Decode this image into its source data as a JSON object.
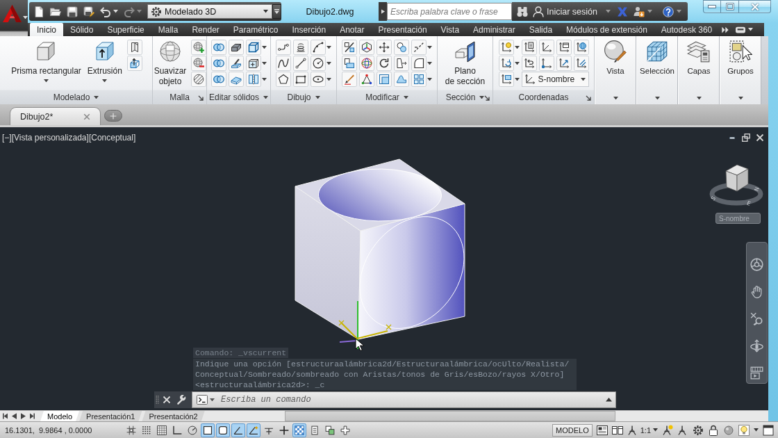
{
  "quick_access": {
    "workspace": "Modelado 3D"
  },
  "window": {
    "title": "Dibujo2.dwg"
  },
  "search": {
    "placeholder": "Escriba palabra clave o frase"
  },
  "account": {
    "label": "Iniciar sesión"
  },
  "ribbon_tabs": [
    {
      "label": "Inicio",
      "selected": true
    },
    {
      "label": "Sólido",
      "selected": false
    },
    {
      "label": "Superficie",
      "selected": false
    },
    {
      "label": "Malla",
      "selected": false
    },
    {
      "label": "Render",
      "selected": false
    },
    {
      "label": "Paramétrico",
      "selected": false
    },
    {
      "label": "Inserción",
      "selected": false
    },
    {
      "label": "Anotar",
      "selected": false
    },
    {
      "label": "Presentación",
      "selected": false
    },
    {
      "label": "Vista",
      "selected": false
    },
    {
      "label": "Administrar",
      "selected": false
    },
    {
      "label": "Salida",
      "selected": false
    },
    {
      "label": "Módulos de extensión",
      "selected": false
    },
    {
      "label": "Autodesk 360",
      "selected": false
    }
  ],
  "ribbon_panels": [
    {
      "kind": "tools",
      "title": "Modelado",
      "menu": true,
      "launcher": false,
      "buttons": [
        {
          "label": "Prisma rectangular",
          "menu": true
        },
        {
          "label": "Extrusión",
          "menu": true
        }
      ]
    },
    {
      "kind": "tools",
      "title": "Malla",
      "menu": false,
      "launcher": true,
      "buttons": [
        {
          "label": "Suavizar\nobjeto",
          "menu": false
        }
      ]
    },
    {
      "kind": "tools",
      "title": "Editar sólidos",
      "menu": true,
      "launcher": false
    },
    {
      "kind": "tools",
      "title": "Dibujo",
      "menu": true,
      "launcher": false
    },
    {
      "kind": "tools",
      "title": "Modificar",
      "menu": true,
      "launcher": false
    },
    {
      "kind": "tools",
      "title": "Sección",
      "menu": true,
      "launcher": true,
      "buttons": [
        {
          "label": "Plano\nde sección",
          "menu": false
        }
      ]
    },
    {
      "kind": "tools",
      "title": "Coordenadas",
      "menu": false,
      "launcher": true,
      "dropdown": "S-nombre"
    },
    {
      "kind": "collapsed",
      "label": "Vista"
    },
    {
      "kind": "collapsed",
      "label": "Selección"
    },
    {
      "kind": "collapsed",
      "label": "Capas"
    },
    {
      "kind": "collapsed",
      "label": "Grupos"
    }
  ],
  "file_tabs": [
    {
      "label": "Dibujo2*",
      "selected": true
    }
  ],
  "viewport": {
    "controls": [
      "[−]",
      "[Vista personalizada]",
      "[Conceptual]"
    ],
    "compass": [
      "S",
      "E",
      "N"
    ],
    "ucs_menu": "S-nombre"
  },
  "command_history": [
    {
      "kind": "command",
      "text": "Comando: _vscurrent"
    },
    {
      "kind": "prompt",
      "text": "Indique una opción [estructuraalámbrica2d/Estructuraalámbrica/ocUlto/Realista/"
    },
    {
      "kind": "prompt",
      "text": "Conceptual/Sombreado/sombreado con Aristas/tonos de Gris/esBozo/rayos X/Otro]"
    },
    {
      "kind": "prompt",
      "text": "<estructuraalámbrica2d>: _c"
    }
  ],
  "command_line": {
    "placeholder": "Escriba un comando"
  },
  "layout_tabs": [
    {
      "label": "Modelo",
      "selected": true
    },
    {
      "label": "Presentación1",
      "selected": false
    },
    {
      "label": "Presentación2",
      "selected": false
    }
  ],
  "status_bar": {
    "coordinates": "16.1301,  9.9864 , 0.0000",
    "toggles": [
      {
        "on": false
      },
      {
        "on": false
      },
      {
        "on": false
      },
      {
        "on": false
      },
      {
        "on": false
      },
      {
        "on": true
      },
      {
        "on": true
      },
      {
        "on": true
      },
      {
        "on": true
      },
      {
        "on": false
      },
      {
        "on": false
      },
      {
        "on": true
      },
      {
        "on": false
      },
      {
        "on": false
      },
      {
        "on": false
      }
    ],
    "space": "MODELO",
    "annotation_scale": "1:1"
  }
}
